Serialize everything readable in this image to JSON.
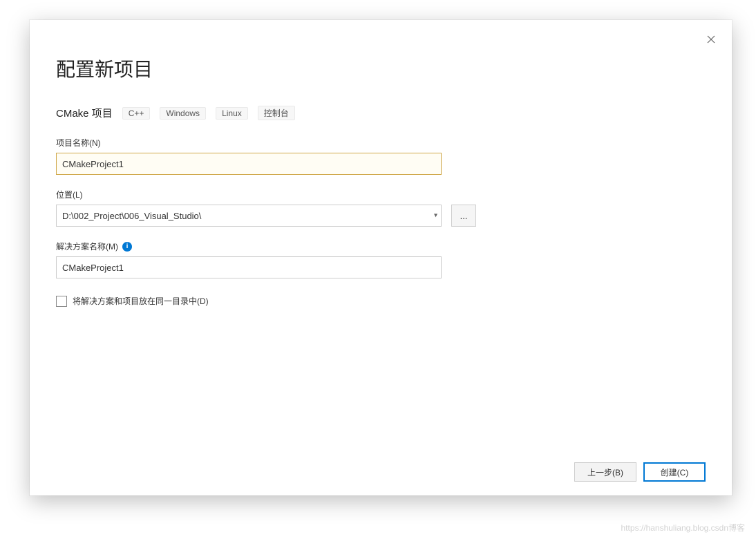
{
  "title": "配置新项目",
  "project_type": "CMake 项目",
  "tags": [
    "C++",
    "Windows",
    "Linux",
    "控制台"
  ],
  "fields": {
    "project_name": {
      "label": "项目名称(N)",
      "value": "CMakeProject1"
    },
    "location": {
      "label": "位置(L)",
      "value": "D:\\002_Project\\006_Visual_Studio\\"
    },
    "solution_name": {
      "label": "解决方案名称(M)",
      "value": "CMakeProject1"
    }
  },
  "browse_label": "...",
  "checkbox_label": "将解决方案和项目放在同一目录中(D)",
  "buttons": {
    "back": "上一步(B)",
    "create": "创建(C)"
  },
  "watermark": "https://hanshuliang.blog.csdn博客"
}
